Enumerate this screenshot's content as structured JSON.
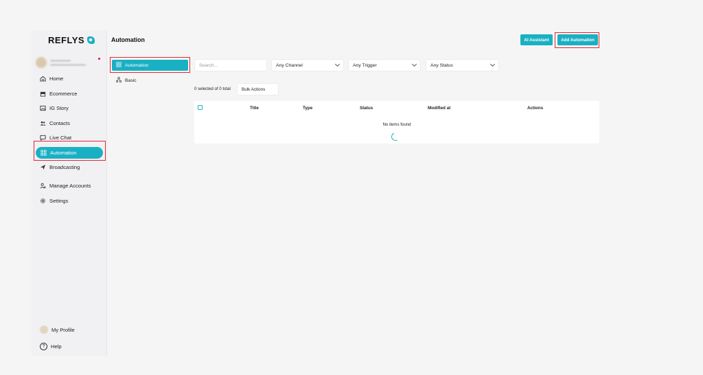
{
  "brand": {
    "name": "REFLYS"
  },
  "sidebar": {
    "items": [
      {
        "label": "Home",
        "icon": "home-icon"
      },
      {
        "label": "Ecommerce",
        "icon": "store-icon"
      },
      {
        "label": "IG Story",
        "icon": "image-icon"
      },
      {
        "label": "Contacts",
        "icon": "users-icon"
      },
      {
        "label": "Live Chat",
        "icon": "chat-icon"
      },
      {
        "label": "Automation",
        "icon": "grid-icon",
        "active": true
      },
      {
        "label": "Broadcasting",
        "icon": "send-icon"
      }
    ],
    "secondary": [
      {
        "label": "Manage Accounts",
        "icon": "user-settings-icon"
      },
      {
        "label": "Settings",
        "icon": "gear-icon"
      }
    ],
    "bottom": [
      {
        "label": "My Profile",
        "icon": "avatar"
      },
      {
        "label": "Help",
        "icon": "help-icon"
      }
    ]
  },
  "header": {
    "title": "Automation",
    "ai_assistant_label": "AI Assistant",
    "add_automation_label": "Add Automation"
  },
  "subnav": {
    "items": [
      {
        "label": "Automation",
        "icon": "grid-icon",
        "active": true
      },
      {
        "label": "Basic",
        "icon": "nodes-icon"
      }
    ]
  },
  "filters": {
    "search_placeholder": "Search...",
    "channel": "Any Channel",
    "trigger": "Any Trigger",
    "status": "Any Status"
  },
  "selection": {
    "count_text": "0 selected of 0 total",
    "bulk_actions_label": "Bulk Actions"
  },
  "table": {
    "columns": [
      "Title",
      "Type",
      "Status",
      "Modified at",
      "Actions"
    ],
    "empty_text": "No items found"
  },
  "colors": {
    "accent": "#1ab0c3",
    "highlight": "#e0252f"
  }
}
